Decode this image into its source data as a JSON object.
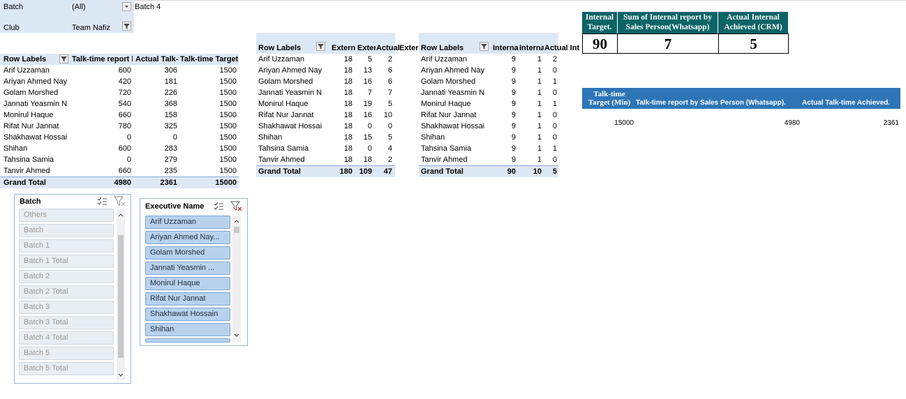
{
  "filters": {
    "batch_label": "Batch",
    "batch_value": "(All)",
    "batch_note": "Batch 4",
    "club_label": "Club",
    "club_value": "Team Nafiz"
  },
  "pivot1": {
    "headers": [
      "Row Labels",
      "Talk-time report b",
      "Actual Talk-t",
      "Talk-time Target (Min"
    ],
    "rows": [
      [
        "Arif Uzzaman",
        "600",
        "306",
        "1500"
      ],
      [
        "Ariyan Ahmed Nay",
        "420",
        "181",
        "1500"
      ],
      [
        "Golam Morshed",
        "720",
        "226",
        "1500"
      ],
      [
        "Jannati Yeasmin N",
        "540",
        "368",
        "1500"
      ],
      [
        "Monirul Haque",
        "660",
        "158",
        "1500"
      ],
      [
        "Rifat Nur Jannat",
        "780",
        "325",
        "1500"
      ],
      [
        "Shakhawat Hossai",
        "0",
        "0",
        "1500"
      ],
      [
        "Shihan",
        "600",
        "283",
        "1500"
      ],
      [
        "Tahsina Samia",
        "0",
        "279",
        "1500"
      ],
      [
        "Tanvir Ahmed",
        "660",
        "235",
        "1500"
      ]
    ],
    "total": [
      "Grand Total",
      "4980",
      "2361",
      "15000"
    ]
  },
  "pivot2": {
    "headers": [
      "Row Labels",
      "Extern",
      "Exter",
      "Actual",
      "Exter"
    ],
    "rows": [
      [
        "Arif Uzzaman",
        "18",
        "5",
        "2"
      ],
      [
        "Ariyan Ahmed Nay",
        "18",
        "13",
        "6"
      ],
      [
        "Golam Morshed",
        "18",
        "16",
        "6"
      ],
      [
        "Jannati Yeasmin N",
        "18",
        "7",
        "7"
      ],
      [
        "Monirul Haque",
        "18",
        "19",
        "5"
      ],
      [
        "Rifat Nur Jannat",
        "18",
        "16",
        "10"
      ],
      [
        "Shakhawat Hossai",
        "18",
        "0",
        "0"
      ],
      [
        "Shihan",
        "18",
        "15",
        "5"
      ],
      [
        "Tahsina Samia",
        "18",
        "0",
        "4"
      ],
      [
        "Tanvir Ahmed",
        "18",
        "18",
        "2"
      ]
    ],
    "total": [
      "Grand Total",
      "180",
      "109",
      "47"
    ]
  },
  "pivot3": {
    "headers": [
      "Row Labels",
      "Interna",
      "Interna",
      "Actual Inte"
    ],
    "rows": [
      [
        "Arif Uzzaman",
        "9",
        "1",
        "2"
      ],
      [
        "Ariyan Ahmed Nay",
        "9",
        "1",
        "0"
      ],
      [
        "Golam Morshed",
        "9",
        "1",
        "1"
      ],
      [
        "Jannati Yeasmin N",
        "9",
        "1",
        "0"
      ],
      [
        "Monirul Haque",
        "9",
        "1",
        "1"
      ],
      [
        "Rifat Nur Jannat",
        "9",
        "1",
        "0"
      ],
      [
        "Shakhawat Hossai",
        "9",
        "1",
        "0"
      ],
      [
        "Shihan",
        "9",
        "1",
        "0"
      ],
      [
        "Tahsina Samia",
        "9",
        "1",
        "1"
      ],
      [
        "Tanvir Ahmed",
        "9",
        "1",
        "0"
      ]
    ],
    "total": [
      "Grand Total",
      "90",
      "10",
      "5"
    ]
  },
  "kpi": {
    "headers": [
      "Internal Target.",
      "Sum of Internal report by Sales Person(Whatsapp)",
      "Actual Internal Achieved  (CRM)"
    ],
    "values": [
      "90",
      "7",
      "5"
    ]
  },
  "talktime": {
    "headers": [
      "Talk-time Target (Min)",
      "Talk-time report by Sales Person (Whatsapp).",
      "Actual Talk-time Achieved."
    ],
    "values": [
      "15000",
      "4980",
      "2361"
    ]
  },
  "slicer_batch": {
    "title": "Batch",
    "items": [
      "Others",
      "Batch",
      "Batch 1",
      "Batch 1 Total",
      "Batch 2",
      "Batch 2 Total",
      "Batch 3",
      "Batch 3 Total",
      "Batch 4 Total",
      "Batch 5",
      "Batch 5 Total"
    ]
  },
  "slicer_exec": {
    "title": "Executive Name",
    "items": [
      "Arif Uzzaman",
      "Ariyan Ahmed Nay...",
      "Golam Morshed",
      "Jannati Yeasmin ...",
      "Monirul Haque",
      "Rifat Nur Jannat",
      "Shakhawat Hossain",
      "Shihan"
    ]
  },
  "colors": {
    "kpi_header": "#0c6466",
    "talktime_header": "#2e75b6",
    "filter_fill": "#dde8f5",
    "slicer_selected": "#b8d2ee"
  }
}
